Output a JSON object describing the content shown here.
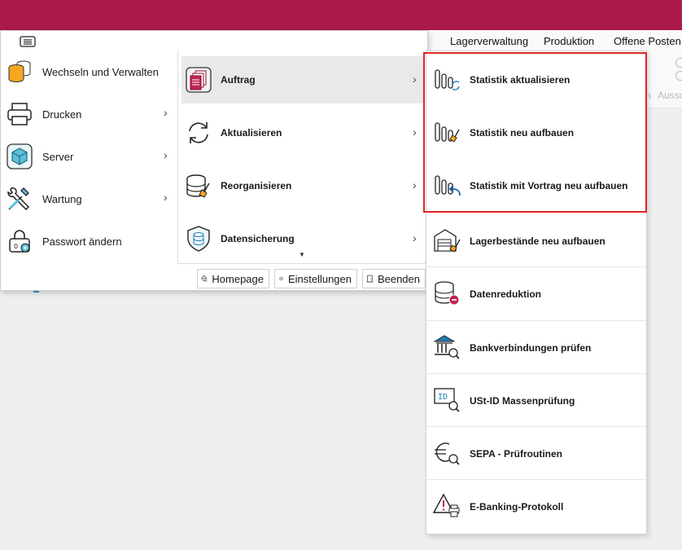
{
  "ribbon": {
    "tabs": [
      "Lagerverwaltung",
      "Produktion",
      "Offene Posten"
    ],
    "ghost_text_1": "n",
    "ghost_text_2": "Aussc"
  },
  "menu": {
    "level1": [
      {
        "label": "Wechseln und Verwalten",
        "icon": "database-switch-icon",
        "has_submenu": false
      },
      {
        "label": "Drucken",
        "icon": "printer-icon",
        "has_submenu": true
      },
      {
        "label": "Server",
        "icon": "server-cube-icon",
        "has_submenu": true
      },
      {
        "label": "Wartung",
        "icon": "wrench-screwdriver-icon",
        "has_submenu": true
      },
      {
        "label": "Passwort ändern",
        "icon": "padlock-gear-icon",
        "has_submenu": false
      }
    ],
    "level2": [
      {
        "label": "Auftrag",
        "icon": "documents-icon",
        "selected": true
      },
      {
        "label": "Aktualisieren",
        "icon": "refresh-icon",
        "selected": false
      },
      {
        "label": "Reorganisieren",
        "icon": "database-broom-icon",
        "selected": false
      },
      {
        "label": "Datensicherung",
        "icon": "shield-database-icon",
        "selected": false
      }
    ],
    "level3": [
      {
        "label": "Statistik aktualisieren",
        "icon": "statistics-refresh-icon"
      },
      {
        "label": "Statistik neu aufbauen",
        "icon": "statistics-broom-icon"
      },
      {
        "label": "Statistik mit Vortrag neu aufbauen",
        "icon": "statistics-carryover-icon"
      },
      {
        "label": "Lagerbestände neu aufbauen",
        "icon": "warehouse-broom-icon"
      },
      {
        "label": "Datenreduktion",
        "icon": "database-minus-icon"
      },
      {
        "label": "Bankverbindungen prüfen",
        "icon": "bank-search-icon"
      },
      {
        "label": "USt-ID Massenprüfung",
        "icon": "id-search-icon"
      },
      {
        "label": "SEPA - Prüfroutinen",
        "icon": "euro-search-icon"
      },
      {
        "label": "E-Banking-Protokoll",
        "icon": "warning-printer-icon"
      }
    ],
    "footer": {
      "homepage": "Homepage",
      "settings": "Einstellungen",
      "quit": "Beenden"
    }
  },
  "colors": {
    "titlebar": "#ab1a48",
    "highlight_border": "#e02424",
    "selected_bg": "#e9e9e9"
  }
}
